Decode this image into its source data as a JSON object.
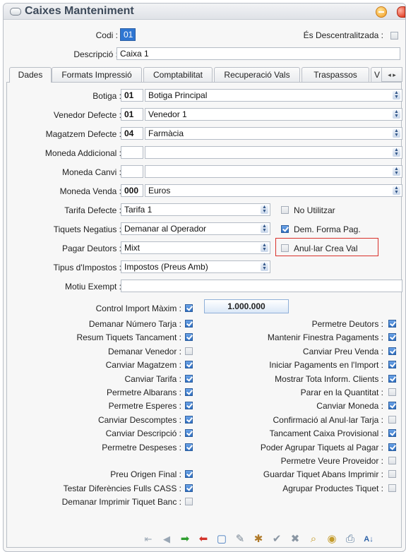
{
  "window": {
    "title": "Caixes Manteniment"
  },
  "header": {
    "codi_label": "Codi :",
    "codi_value": "01",
    "descentralitzada_label": "És Descentralitzada :",
    "descripcio_label": "Descripció :",
    "descripcio_value": "Caixa 1"
  },
  "tabs": [
    "Dades",
    "Formats Impressió",
    "Comptabilitat",
    "Recuperació Vals",
    "Traspassos",
    "V"
  ],
  "fields": {
    "botiga": {
      "label": "Botiga :",
      "code": "01",
      "value": "Botiga Principal"
    },
    "venedor": {
      "label": "Venedor Defecte :",
      "code": "01",
      "value": "Venedor 1"
    },
    "magatzem": {
      "label": "Magatzem Defecte :",
      "code": "04",
      "value": "Farmàcia"
    },
    "moneda_add": {
      "label": "Moneda Addicional :",
      "code": "",
      "value": ""
    },
    "moneda_canvi": {
      "label": "Moneda Canvi :",
      "code": "",
      "value": ""
    },
    "moneda_venda": {
      "label": "Moneda Venda :",
      "code": "000",
      "value": "Euros"
    },
    "tarifa": {
      "label": "Tarifa Defecte :",
      "value": "Tarifa 1"
    },
    "tiquets_neg": {
      "label": "Tiquets Negatius :",
      "value": "Demanar al Operador"
    },
    "pagar_deutors": {
      "label": "Pagar Deutors :",
      "value": "Mixt"
    },
    "tipus_impostos": {
      "label": "Tipus d'Impostos :",
      "value": "Impostos (Preus Amb)"
    },
    "motiu_exempt": {
      "label": "Motiu Exempt :",
      "value": ""
    }
  },
  "side_checks": {
    "no_utilitzar": "No Utilitzar",
    "dem_forma_pag": "Dem. Forma Pag.",
    "anular_crea_val": "Anul·lar Crea Val"
  },
  "control_import": {
    "label": "Control Import Màxim :",
    "value": "1.000.000"
  },
  "left_checks": [
    {
      "label": "Demanar Número Tarja :",
      "checked": true
    },
    {
      "label": "Resum Tiquets Tancament :",
      "checked": true
    },
    {
      "label": "Demanar Venedor :",
      "checked": false
    },
    {
      "label": "Canviar Magatzem :",
      "checked": true
    },
    {
      "label": "Canviar Tarifa :",
      "checked": true
    },
    {
      "label": "Permetre Albarans :",
      "checked": true
    },
    {
      "label": "Permetre Esperes :",
      "checked": true
    },
    {
      "label": "Canviar Descomptes :",
      "checked": true
    },
    {
      "label": "Canviar Descripció :",
      "checked": true
    },
    {
      "label": "Permetre Despeses :",
      "checked": true
    },
    {
      "label": "",
      "checked": null
    },
    {
      "label": "Preu Origen Final :",
      "checked": true
    },
    {
      "label": "Testar Diferències Fulls CASS :",
      "checked": true
    },
    {
      "label": "Demanar Imprimir Tiquet Banc :",
      "checked": false
    }
  ],
  "right_checks": [
    {
      "label": "Permetre Deutors :",
      "checked": true
    },
    {
      "label": "Mantenir Finestra Pagaments :",
      "checked": true
    },
    {
      "label": "Canviar Preu Venda :",
      "checked": true
    },
    {
      "label": "Iniciar Pagaments en l'Import :",
      "checked": true
    },
    {
      "label": "Mostrar Tota Inform. Clients :",
      "checked": true
    },
    {
      "label": "Parar en la Quantitat :",
      "checked": false
    },
    {
      "label": "Canviar Moneda :",
      "checked": true
    },
    {
      "label": "Confirmació al Anul·lar Tarja :",
      "checked": false
    },
    {
      "label": "Tancament Caixa Provisional :",
      "checked": true
    },
    {
      "label": "Poder Agrupar Tiquets al Pagar :",
      "checked": true
    },
    {
      "label": "Permetre Veure Proveidor :",
      "checked": false
    },
    {
      "label": "Guardar Tiquet Abans Imprimir :",
      "checked": false
    },
    {
      "label": "Agrupar Productes Tiquet :",
      "checked": false
    }
  ],
  "toolbar": [
    {
      "icon": "first-record-icon",
      "glyph": "⇤",
      "color": "#9aa7b5"
    },
    {
      "icon": "previous-record-icon",
      "glyph": "◀",
      "color": "#9aa7b5"
    },
    {
      "icon": "next-record-icon",
      "glyph": "➡",
      "color": "#2f9e2f"
    },
    {
      "icon": "last-record-icon",
      "glyph": "➡",
      "color": "#d3332a"
    },
    {
      "icon": "new-document-icon",
      "glyph": "▢",
      "color": "#4a7fc1"
    },
    {
      "icon": "edit-icon",
      "glyph": "✎",
      "color": "#7a8896"
    },
    {
      "icon": "cancel-edit-icon",
      "glyph": "✱",
      "color": "#b07a2a"
    },
    {
      "icon": "confirm-icon",
      "glyph": "✔",
      "color": "#8a96a3"
    },
    {
      "icon": "delete-icon",
      "glyph": "✖",
      "color": "#8a96a3"
    },
    {
      "icon": "search-icon",
      "glyph": "⌕",
      "color": "#c49b2a"
    },
    {
      "icon": "view-icon",
      "glyph": "◉",
      "color": "#c49b2a"
    },
    {
      "icon": "print-icon",
      "glyph": "⎙",
      "color": "#5e7d9e"
    },
    {
      "icon": "sort-icon",
      "glyph": "A↓",
      "color": "#2d62a8"
    }
  ]
}
